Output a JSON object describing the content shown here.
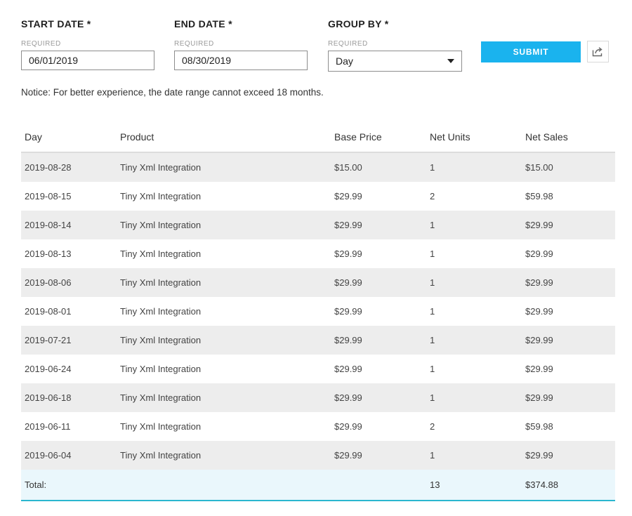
{
  "filters": {
    "start_date": {
      "label": "START DATE *",
      "sub": "REQUIRED",
      "value": "06/01/2019"
    },
    "end_date": {
      "label": "END DATE *",
      "sub": "REQUIRED",
      "value": "08/30/2019"
    },
    "group_by": {
      "label": "GROUP BY *",
      "sub": "REQUIRED",
      "value": "Day"
    }
  },
  "actions": {
    "submit_label": "SUBMIT",
    "export_icon": "share-export-icon"
  },
  "notice": "Notice: For better experience, the date range cannot exceed 18 months.",
  "table": {
    "headers": [
      "Day",
      "Product",
      "Base Price",
      "Net Units",
      "Net Sales"
    ],
    "rows": [
      [
        "2019-08-28",
        "Tiny Xml Integration",
        "$15.00",
        "1",
        "$15.00"
      ],
      [
        "2019-08-15",
        "Tiny Xml Integration",
        "$29.99",
        "2",
        "$59.98"
      ],
      [
        "2019-08-14",
        "Tiny Xml Integration",
        "$29.99",
        "1",
        "$29.99"
      ],
      [
        "2019-08-13",
        "Tiny Xml Integration",
        "$29.99",
        "1",
        "$29.99"
      ],
      [
        "2019-08-06",
        "Tiny Xml Integration",
        "$29.99",
        "1",
        "$29.99"
      ],
      [
        "2019-08-01",
        "Tiny Xml Integration",
        "$29.99",
        "1",
        "$29.99"
      ],
      [
        "2019-07-21",
        "Tiny Xml Integration",
        "$29.99",
        "1",
        "$29.99"
      ],
      [
        "2019-06-24",
        "Tiny Xml Integration",
        "$29.99",
        "1",
        "$29.99"
      ],
      [
        "2019-06-18",
        "Tiny Xml Integration",
        "$29.99",
        "1",
        "$29.99"
      ],
      [
        "2019-06-11",
        "Tiny Xml Integration",
        "$29.99",
        "2",
        "$59.98"
      ],
      [
        "2019-06-04",
        "Tiny Xml Integration",
        "$29.99",
        "1",
        "$29.99"
      ]
    ],
    "total": {
      "label": "Total:",
      "net_units": "13",
      "net_sales": "$374.88"
    }
  },
  "colors": {
    "accent": "#1ab3ee",
    "total_row_bg": "#eaf7fc",
    "total_row_border": "#2bb6cf",
    "stripe": "#ededed"
  }
}
